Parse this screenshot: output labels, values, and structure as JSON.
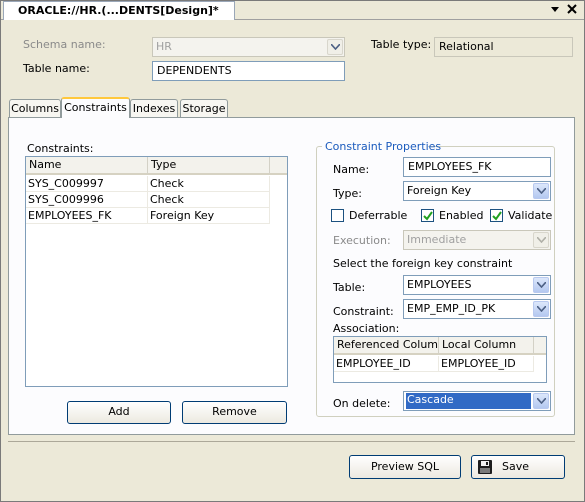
{
  "window": {
    "tab_title": "ORACLE://HR.(...DENTS[Design]*"
  },
  "header": {
    "schema_label": "Schema name:",
    "schema_value": "HR",
    "table_name_label": "Table name:",
    "table_name_value": "DEPENDENTS",
    "table_type_label": "Table type:",
    "table_type_value": "Relational"
  },
  "tabs": [
    {
      "label": "Columns"
    },
    {
      "label": "Constraints"
    },
    {
      "label": "Indexes"
    },
    {
      "label": "Storage"
    }
  ],
  "constraints": {
    "label": "Constraints:",
    "columns": [
      "Name",
      "Type"
    ],
    "rows": [
      {
        "name": "SYS_C009997",
        "type": "Check"
      },
      {
        "name": "SYS_C009996",
        "type": "Check"
      },
      {
        "name": "EMPLOYEES_FK",
        "type": "Foreign Key"
      }
    ],
    "add_label": "Add",
    "remove_label": "Remove"
  },
  "properties": {
    "title": "Constraint Properties",
    "name_label": "Name:",
    "name_value": "EMPLOYEES_FK",
    "type_label": "Type:",
    "type_value": "Foreign Key",
    "deferrable_label": "Deferrable",
    "deferrable_checked": false,
    "enabled_label": "Enabled",
    "enabled_checked": true,
    "validate_label": "Validate",
    "validate_checked": true,
    "execution_label": "Execution:",
    "execution_value": "Immediate",
    "fk_prompt": "Select the foreign key constraint",
    "table_label": "Table:",
    "table_value": "EMPLOYEES",
    "constraint_label": "Constraint:",
    "constraint_value": "EMP_EMP_ID_PK",
    "association_label": "Association:",
    "association_columns": [
      "Referenced Column",
      "Local Column"
    ],
    "association_rows": [
      {
        "referenced": "EMPLOYEE_ID",
        "local": "EMPLOYEE_ID"
      }
    ],
    "on_delete_label": "On delete:",
    "on_delete_value": "Cascade"
  },
  "footer": {
    "preview_sql_label": "Preview SQL",
    "save_label": "Save"
  },
  "colors": {
    "window_bg": "#ece9d8",
    "panel_bg": "#fcfcfe",
    "selection": "#316ac5",
    "group_title": "#1b5bbd",
    "active_tab_accent": "#ffc83c"
  }
}
